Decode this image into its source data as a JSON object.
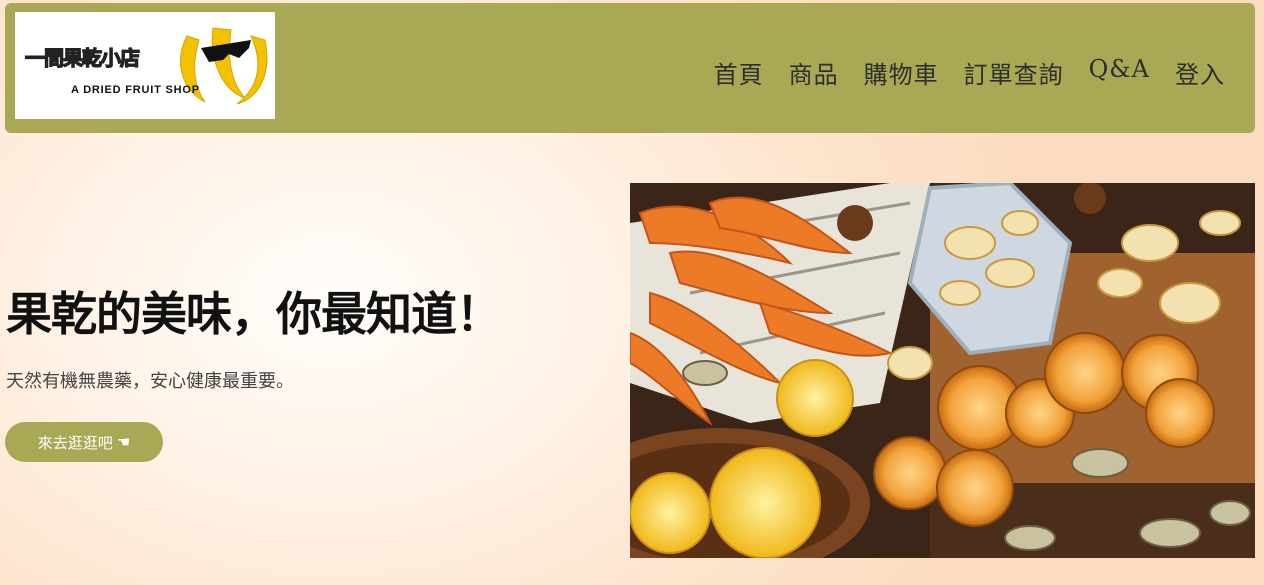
{
  "logo": {
    "title": "一間果乾小店",
    "subtitle": "A DRIED FRUIT SHOP"
  },
  "nav": {
    "items": [
      "首頁",
      "商品",
      "購物車",
      "訂單查詢",
      "Q&A",
      "登入"
    ]
  },
  "hero": {
    "title": "果乾的美味，你最知道！",
    "subtitle": "天然有機無農藥，安心健康最重要。",
    "cta_label": "來去逛逛吧",
    "cta_icon": "☚"
  },
  "colors": {
    "header_bg": "#a8a855",
    "button_bg": "#a8a855"
  }
}
